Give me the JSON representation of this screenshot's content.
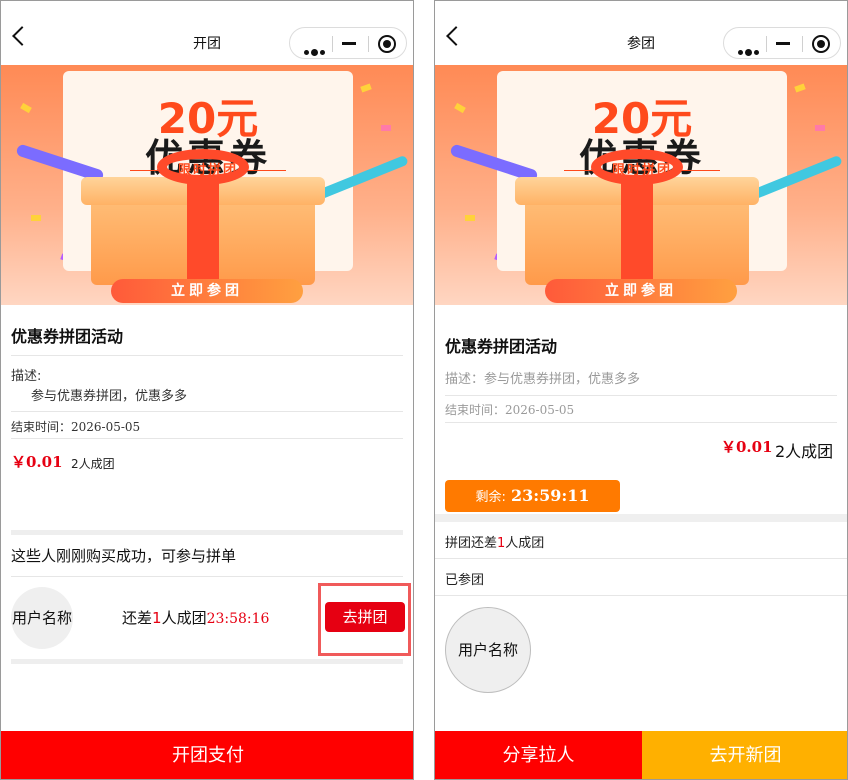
{
  "left": {
    "nav_title": "开团",
    "banner": {
      "amount": "20元",
      "coupon": "优惠券",
      "limited": "限时拼团",
      "cta": "立即参团"
    },
    "activity_title": "优惠券拼团活动",
    "desc_label": "描述:",
    "desc_text": "参与优惠券拼团，优惠多多",
    "end_time": "结束时间：2026-05-05",
    "price": "￥0.01",
    "group_size": "2人成团",
    "intro": "这些人刚刚购买成功，可参与拼单",
    "member": {
      "avatar_text": "用户名称",
      "short_prefix": "还差",
      "short_count": "1",
      "short_suffix": "人成团",
      "countdown": "23:58:16",
      "join_label": "去拼团"
    },
    "pay_label": "开团支付"
  },
  "right": {
    "nav_title": "参团",
    "banner": {
      "amount": "20元",
      "coupon": "优惠券",
      "limited": "限时拼团",
      "cta": "立即参团"
    },
    "activity_title": "优惠券拼团活动",
    "desc_text": "描述：参与优惠券拼团，优惠多多",
    "end_time": "结束时间：2026-05-05",
    "price": "￥0.01",
    "group_size": "2人成团",
    "remaining_label": "剩余:",
    "remaining_time": "23:59:11",
    "need_prefix": "拼团还差",
    "need_count": "1",
    "need_suffix": "人成团",
    "joined_label": "已参团",
    "avatar_text": "用户名称",
    "share_label": "分享拉人",
    "new_group_label": "去开新团"
  },
  "colors": {
    "primary_red": "#ff0000",
    "price_red": "#e60012",
    "orange": "#ff7a00",
    "yellow": "#ffb000",
    "highlight": "#f05a5a"
  },
  "icons": [
    "back-icon",
    "more-icon",
    "minimize-icon",
    "target-icon"
  ]
}
